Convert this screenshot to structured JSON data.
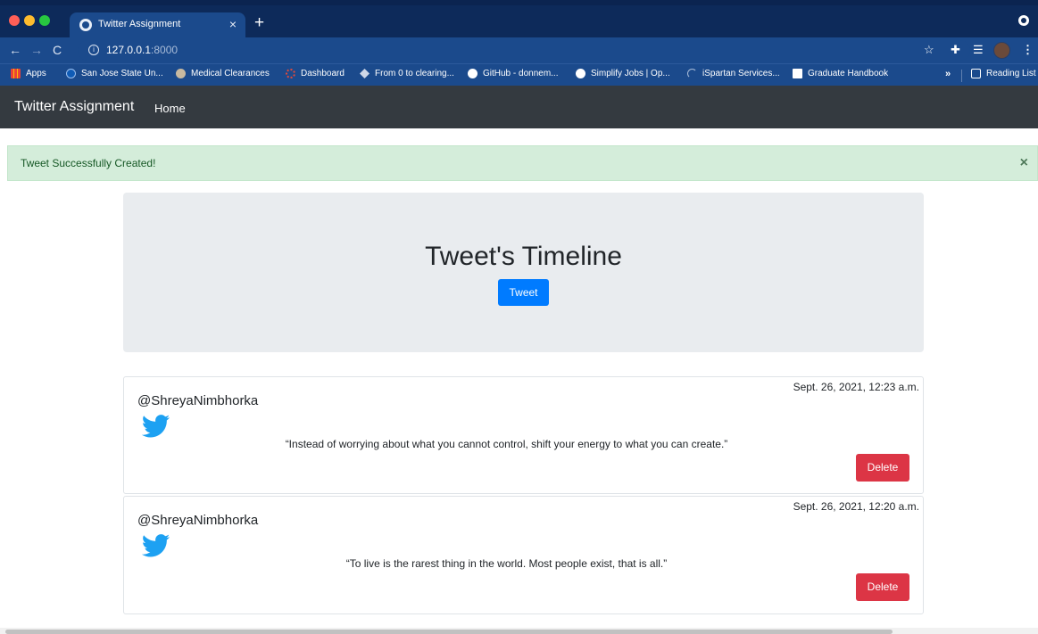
{
  "browser": {
    "tab_title": "Twitter Assignment",
    "tab_close": "×",
    "new_tab": "+",
    "url_host": "127.0.0.1",
    "url_port": ":8000",
    "nav_icons": {
      "back": "←",
      "forward": "→",
      "reload": "C",
      "info": "i",
      "star": "☆",
      "puzzle": "✚",
      "reading": "☰",
      "menu": "⋮"
    },
    "bookmarks": [
      {
        "label": "Apps",
        "icon": "apps-grid-icon"
      },
      {
        "label": "San Jose State Un...",
        "icon": "sjsu-icon"
      },
      {
        "label": "Medical Clearances",
        "icon": "medical-icon"
      },
      {
        "label": "Dashboard",
        "icon": "dashboard-icon"
      },
      {
        "label": "From 0 to clearing...",
        "icon": "diamond-icon"
      },
      {
        "label": "GitHub - donnem...",
        "icon": "github-icon"
      },
      {
        "label": "Simplify Jobs | Op...",
        "icon": "simplify-icon"
      },
      {
        "label": "iSpartan Services...",
        "icon": "ispartan-icon"
      },
      {
        "label": "Graduate Handbook",
        "icon": "handbook-icon"
      }
    ],
    "bookmarks_more": "»",
    "reading_list": "Reading List"
  },
  "navbar": {
    "brand": "Twitter Assignment",
    "home": "Home"
  },
  "alert": {
    "message": "Tweet Successfully Created!",
    "close": "×",
    "color": "#155724"
  },
  "jumbotron": {
    "title": "Tweet's Timeline",
    "button_label": "Tweet"
  },
  "tweets": [
    {
      "timestamp": "Sept. 26, 2021, 12:23 a.m.",
      "username": "@ShreyaNimbhorka",
      "icon": "twitter-bird-icon",
      "text": "“Instead of worrying about what you cannot control, shift your energy to what you can create.”",
      "delete_label": "Delete"
    },
    {
      "timestamp": "Sept. 26, 2021, 12:20 a.m.",
      "username": "@ShreyaNimbhorka",
      "icon": "twitter-bird-icon",
      "text": "“To live is the rarest thing in the world. Most people exist, that is all.”",
      "delete_label": "Delete"
    }
  ],
  "colors": {
    "primary": "#007bff",
    "danger": "#dc3545",
    "navbar": "#343a40",
    "twitter_blue": "#1da1f2"
  }
}
